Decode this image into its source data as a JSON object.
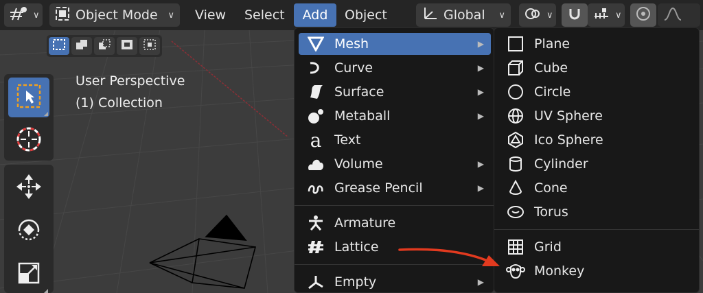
{
  "header": {
    "editor_icon": "viewport-editor-icon",
    "mode_label": "Object Mode",
    "menus": [
      {
        "label": "View"
      },
      {
        "label": "Select"
      },
      {
        "label": "Add"
      },
      {
        "label": "Object"
      }
    ],
    "orientation_label": "Global"
  },
  "viewport_overlay": {
    "line1": "User Perspective",
    "line2": "(1) Collection"
  },
  "add_menu": {
    "items": [
      {
        "label": "Mesh",
        "icon": "mesh-icon",
        "has_submenu": true
      },
      {
        "label": "Curve",
        "icon": "curve-icon",
        "has_submenu": true
      },
      {
        "label": "Surface",
        "icon": "surface-icon",
        "has_submenu": true
      },
      {
        "label": "Metaball",
        "icon": "metaball-icon",
        "has_submenu": true
      },
      {
        "label": "Text",
        "icon": "text-icon",
        "has_submenu": false
      },
      {
        "label": "Volume",
        "icon": "volume-icon",
        "has_submenu": true
      },
      {
        "label": "Grease Pencil",
        "icon": "grease-pencil-icon",
        "has_submenu": true
      },
      {
        "label": "Armature",
        "icon": "armature-icon",
        "has_submenu": false
      },
      {
        "label": "Lattice",
        "icon": "lattice-icon",
        "has_submenu": false
      },
      {
        "label": "Empty",
        "icon": "empty-icon",
        "has_submenu": true
      }
    ]
  },
  "mesh_submenu": {
    "items": [
      {
        "label": "Plane",
        "icon": "plane-icon"
      },
      {
        "label": "Cube",
        "icon": "cube-icon"
      },
      {
        "label": "Circle",
        "icon": "circle-icon"
      },
      {
        "label": "UV Sphere",
        "icon": "uv-sphere-icon"
      },
      {
        "label": "Ico Sphere",
        "icon": "ico-sphere-icon"
      },
      {
        "label": "Cylinder",
        "icon": "cylinder-icon"
      },
      {
        "label": "Cone",
        "icon": "cone-icon"
      },
      {
        "label": "Torus",
        "icon": "torus-icon"
      },
      {
        "label": "Grid",
        "icon": "grid-icon"
      },
      {
        "label": "Monkey",
        "icon": "monkey-icon"
      }
    ]
  },
  "colors": {
    "accent": "#4772b3",
    "annotation_arrow": "#e23a1f",
    "menu_bg": "#181818"
  }
}
